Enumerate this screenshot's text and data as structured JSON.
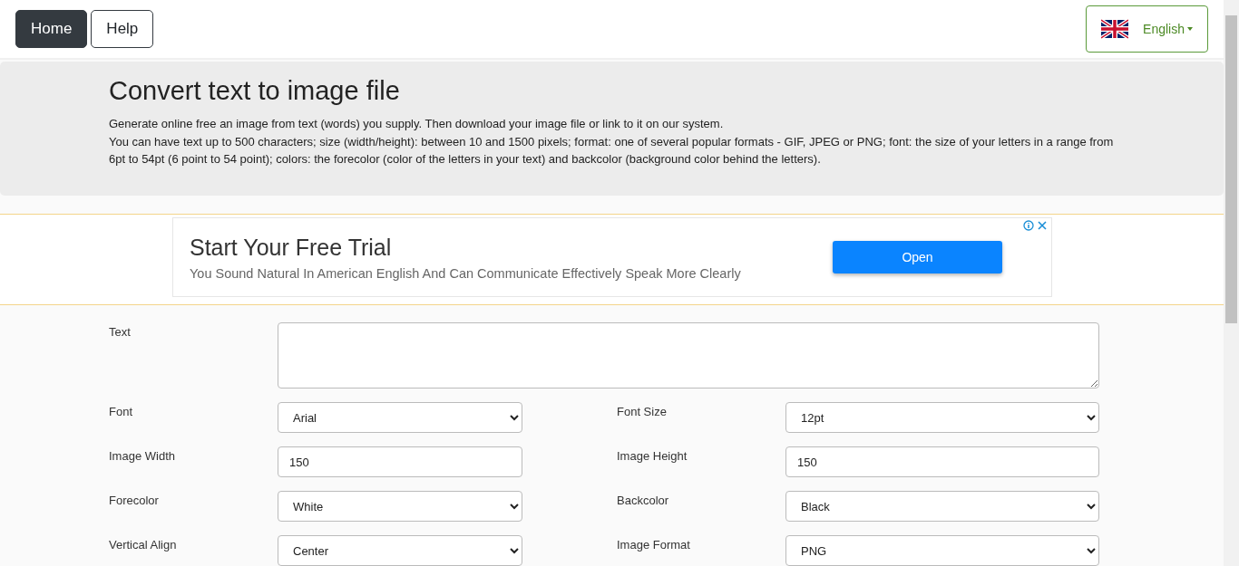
{
  "nav": {
    "buttons": [
      {
        "label": "Home",
        "selected": true
      },
      {
        "label": "Help",
        "selected": false
      }
    ],
    "language": "English"
  },
  "header": {
    "title": "Convert text to image file",
    "lines": [
      "Generate online free an image from text (words) you supply. Then download your image file or link to it on our system.",
      "You can have text up to 500 characters; size (width/height): between 10 and 1500 pixels; format: one of several popular formats - GIF, JPEG or PNG; font: the size of your letters in a range from 6pt to 54pt (6 point to 54 point); colors: the forecolor (color of the letters in your text) and backcolor (background color behind the letters)."
    ]
  },
  "ad": {
    "title": "Start Your Free Trial",
    "text": "You Sound Natural In American English And Can Communicate Effectively Speak More Clearly",
    "button": "Open"
  },
  "form": {
    "rows": [
      [
        {
          "label": "Text",
          "kind": "textarea"
        }
      ],
      [
        {
          "label": "Font",
          "kind": "select",
          "value": "Arial"
        },
        {
          "label": "Font Size",
          "kind": "select",
          "value": "12pt"
        }
      ],
      [
        {
          "label": "Image Width",
          "kind": "input",
          "value": "150"
        },
        {
          "label": "Image Height",
          "kind": "input",
          "value": "150"
        }
      ],
      [
        {
          "label": "Forecolor",
          "kind": "select",
          "value": "White"
        },
        {
          "label": "Backcolor",
          "kind": "select",
          "value": "Black"
        }
      ],
      [
        {
          "label": "Vertical Align",
          "kind": "select",
          "value": "Center"
        },
        {
          "label": "Image Format",
          "kind": "select",
          "value": "PNG"
        }
      ]
    ]
  }
}
